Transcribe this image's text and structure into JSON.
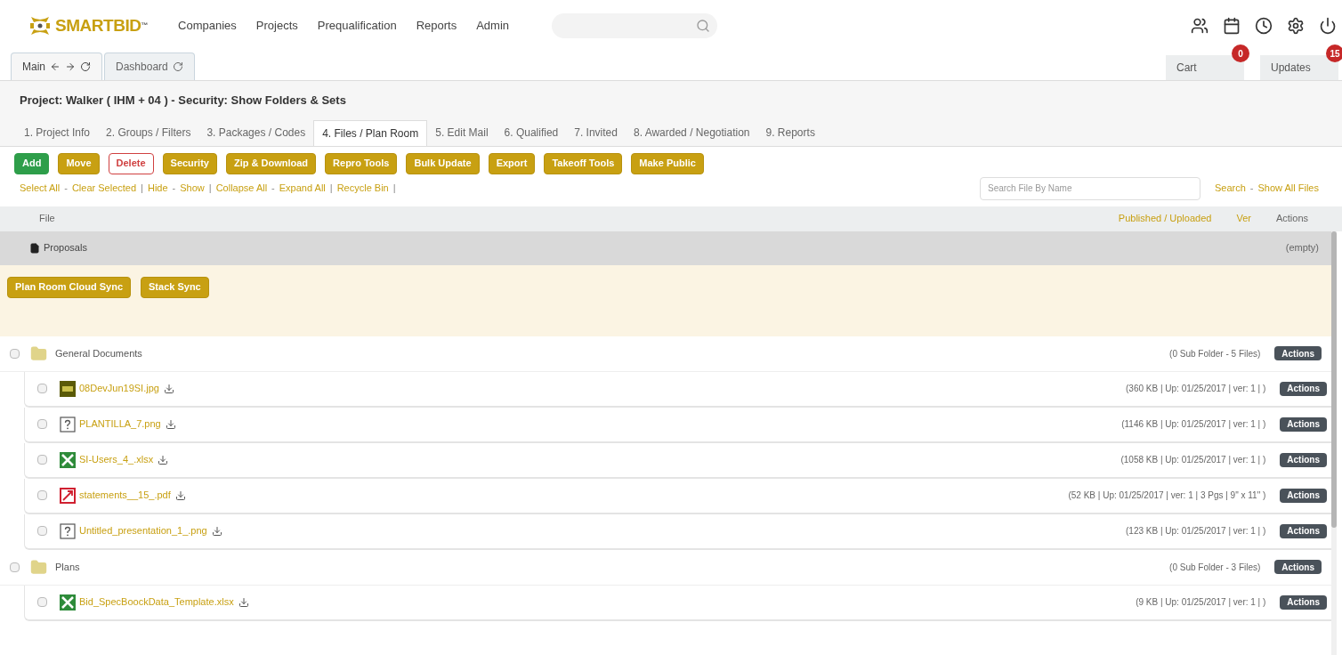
{
  "header": {
    "logo": "SMARTBID",
    "logo_mark": "™",
    "menu": [
      "Companies",
      "Projects",
      "Prequalification",
      "Reports",
      "Admin"
    ]
  },
  "window_tabs": [
    {
      "label": "Main",
      "arrows": true,
      "refresh": true,
      "selected": true
    },
    {
      "label": "Dashboard",
      "arrows": false,
      "refresh": true,
      "selected": false
    }
  ],
  "right_tabs": [
    {
      "label": "Cart",
      "badge": "0"
    },
    {
      "label": "Updates",
      "badge": "15"
    }
  ],
  "project_title": "Project: Walker ( IHM + 04 )  - Security: Show Folders & Sets",
  "step_tabs": [
    {
      "label": "1. Project Info",
      "selected": false
    },
    {
      "label": "2. Groups / Filters",
      "selected": false
    },
    {
      "label": "3. Packages / Codes",
      "selected": false
    },
    {
      "label": "4. Files / Plan Room",
      "selected": true
    },
    {
      "label": "5. Edit Mail",
      "selected": false
    },
    {
      "label": "6. Qualified",
      "selected": false
    },
    {
      "label": "7. Invited",
      "selected": false
    },
    {
      "label": "8. Awarded / Negotiation",
      "selected": false
    },
    {
      "label": "9. Reports",
      "selected": false
    }
  ],
  "toolbar": [
    {
      "label": "Add",
      "kind": "add"
    },
    {
      "label": "Move",
      "kind": "gold"
    },
    {
      "label": "Delete",
      "kind": "outline"
    },
    {
      "label": "Security",
      "kind": "gold"
    },
    {
      "label": "Zip & Download",
      "kind": "gold"
    },
    {
      "label": "Repro Tools",
      "kind": "gold"
    },
    {
      "label": "Bulk Update",
      "kind": "gold"
    },
    {
      "label": "Export",
      "kind": "gold"
    },
    {
      "label": "Takeoff Tools",
      "kind": "gold"
    },
    {
      "label": "Make Public",
      "kind": "gold"
    }
  ],
  "links": [
    {
      "kind": "link",
      "text": "Select All"
    },
    {
      "kind": "sep",
      "text": "-"
    },
    {
      "kind": "link",
      "text": "Clear Selected"
    },
    {
      "kind": "sep",
      "text": "|"
    },
    {
      "kind": "link",
      "text": "Hide"
    },
    {
      "kind": "sep",
      "text": "-"
    },
    {
      "kind": "link",
      "text": "Show"
    },
    {
      "kind": "sep",
      "text": "|"
    },
    {
      "kind": "link",
      "text": "Collapse All"
    },
    {
      "kind": "sep",
      "text": "-"
    },
    {
      "kind": "link",
      "text": "Expand All"
    },
    {
      "kind": "sep",
      "text": "|"
    },
    {
      "kind": "link",
      "text": "Recycle Bin"
    },
    {
      "kind": "sep",
      "text": "|"
    }
  ],
  "file_search": {
    "placeholder": "Search File By Name",
    "links": [
      {
        "kind": "link",
        "text": "Search"
      },
      {
        "kind": "sep",
        "text": "-"
      },
      {
        "kind": "link",
        "text": "Show All Files"
      }
    ]
  },
  "table": {
    "columns": [
      {
        "kind": "plain",
        "text": "File"
      },
      {
        "kind": "link",
        "text": "Published / Uploaded"
      },
      {
        "kind": "link",
        "text": "Ver"
      },
      {
        "kind": "plain",
        "text": "Actions"
      }
    ]
  },
  "proposals": {
    "name": "Proposals",
    "status": "(empty)",
    "buttons": [
      "Plan Room Cloud Sync",
      "Stack Sync"
    ]
  },
  "folders": [
    {
      "name": "General Documents",
      "summary": "(0 Sub Folder - 5 Files)",
      "action": "Actions",
      "checked": false,
      "files": [
        {
          "name": "08DevJun19SI.jpg",
          "kind": "jpg",
          "info": "(360 KB | Up: 01/25/2017 | ver: 1 | )",
          "action": "Actions",
          "checked": false
        },
        {
          "name": "PLANTILLA_7.png",
          "kind": "unknown",
          "info": "(1146 KB | Up: 01/25/2017 | ver: 1 | )",
          "action": "Actions",
          "checked": false
        },
        {
          "name": "SI-Users_4_.xlsx",
          "kind": "xlsx",
          "info": "(1058 KB | Up: 01/25/2017 | ver: 1 | )",
          "action": "Actions",
          "checked": false
        },
        {
          "name": "statements__15_.pdf",
          "kind": "pdf",
          "info": "(52 KB | Up: 01/25/2017 | ver: 1 | 3 Pgs | 9\" x 11\" )",
          "action": "Actions",
          "checked": false
        },
        {
          "name": "Untitled_presentation_1_.png",
          "kind": "unknown",
          "info": "(123 KB | Up: 01/25/2017 | ver: 1 | )",
          "action": "Actions",
          "checked": false
        }
      ]
    },
    {
      "name": "Plans",
      "summary": "(0 Sub Folder - 3 Files)",
      "action": "Actions",
      "checked": false,
      "files": [
        {
          "name": "Bid_SpecBoockData_Template.xlsx",
          "kind": "xlsx",
          "info": "(9 KB | Up: 01/25/2017 | ver: 1 | )",
          "action": "Actions",
          "checked": false
        }
      ]
    }
  ]
}
